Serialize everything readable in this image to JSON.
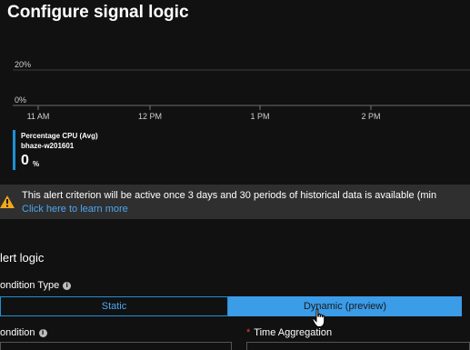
{
  "title": "Configure signal logic",
  "chart": {
    "y_labels": [
      "20%",
      "0%"
    ],
    "x_labels": [
      "11 AM",
      "12 PM",
      "1 PM",
      "2 PM"
    ]
  },
  "chart_data": {
    "type": "line",
    "title": "",
    "xlabel": "",
    "ylabel": "",
    "x": [
      "11 AM",
      "12 PM",
      "1 PM",
      "2 PM"
    ],
    "y_ticks": [
      "0%",
      "20%"
    ],
    "ylim": [
      0,
      20
    ],
    "series": [
      {
        "name": "Percentage CPU (Avg)",
        "values": []
      }
    ],
    "grid": true,
    "legend": "bottom-left"
  },
  "legend": {
    "series": "Percentage CPU (Avg)",
    "resource": "bhaze-w201601",
    "value": "0",
    "unit": "%",
    "color": "#1e90d6"
  },
  "banner": {
    "icon": "warning-icon",
    "text": "This alert criterion will be active once 3 days and 30 periods of historical data is available (min",
    "link": "Click here to learn more"
  },
  "alert_logic": {
    "section_title": "lert logic",
    "condition_type_label": "ondition Type",
    "options": [
      "Static",
      "Dynamic (preview)"
    ],
    "selected": "Dynamic (preview)",
    "condition_label": "ondition",
    "time_aggregation_required": "*",
    "time_aggregation_label": "Time Aggregation"
  },
  "colors": {
    "background": "#111111",
    "accent": "#1e90d6",
    "link": "#4ea6f0",
    "selected_toggle": "#3b9ce8",
    "required": "#e0443c"
  }
}
